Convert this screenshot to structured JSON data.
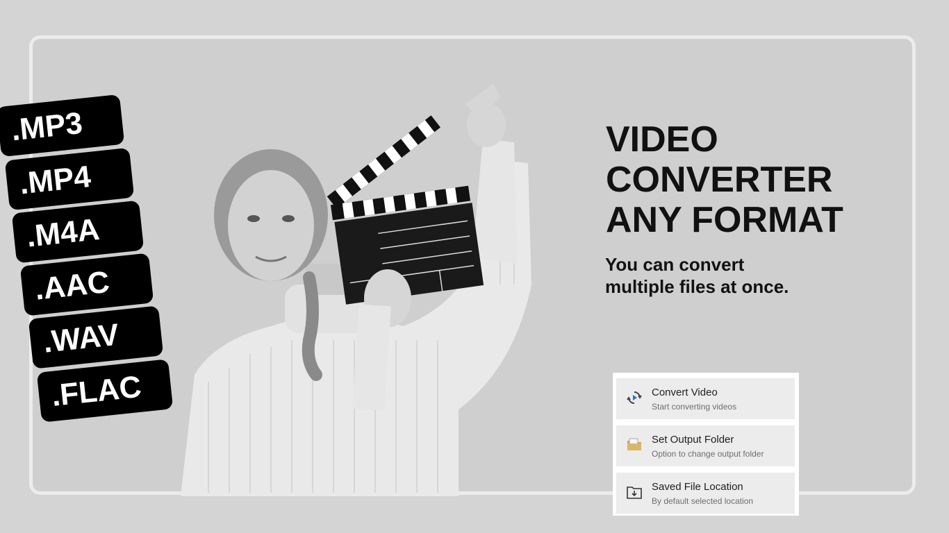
{
  "formats": [
    ".MP3",
    ".MP4",
    ".M4A",
    ".AAC",
    ".WAV",
    ".FLAC"
  ],
  "headline": {
    "line1": "VIDEO",
    "line2": "CONVERTER",
    "line3": "ANY FORMAT"
  },
  "subline": {
    "line1": "You can convert",
    "line2": "multiple files at once."
  },
  "menu": {
    "items": [
      {
        "title": "Convert Video",
        "subtitle": "Start converting videos",
        "icon": "convert-icon"
      },
      {
        "title": "Set Output Folder",
        "subtitle": "Option to change output folder",
        "icon": "folder-icon"
      },
      {
        "title": "Saved File Location",
        "subtitle": "By default selected location",
        "icon": "download-folder-icon"
      }
    ]
  },
  "colors": {
    "background": "#d4d4d4",
    "badge": "#000000",
    "accent_blue": "#2f6fd6"
  }
}
